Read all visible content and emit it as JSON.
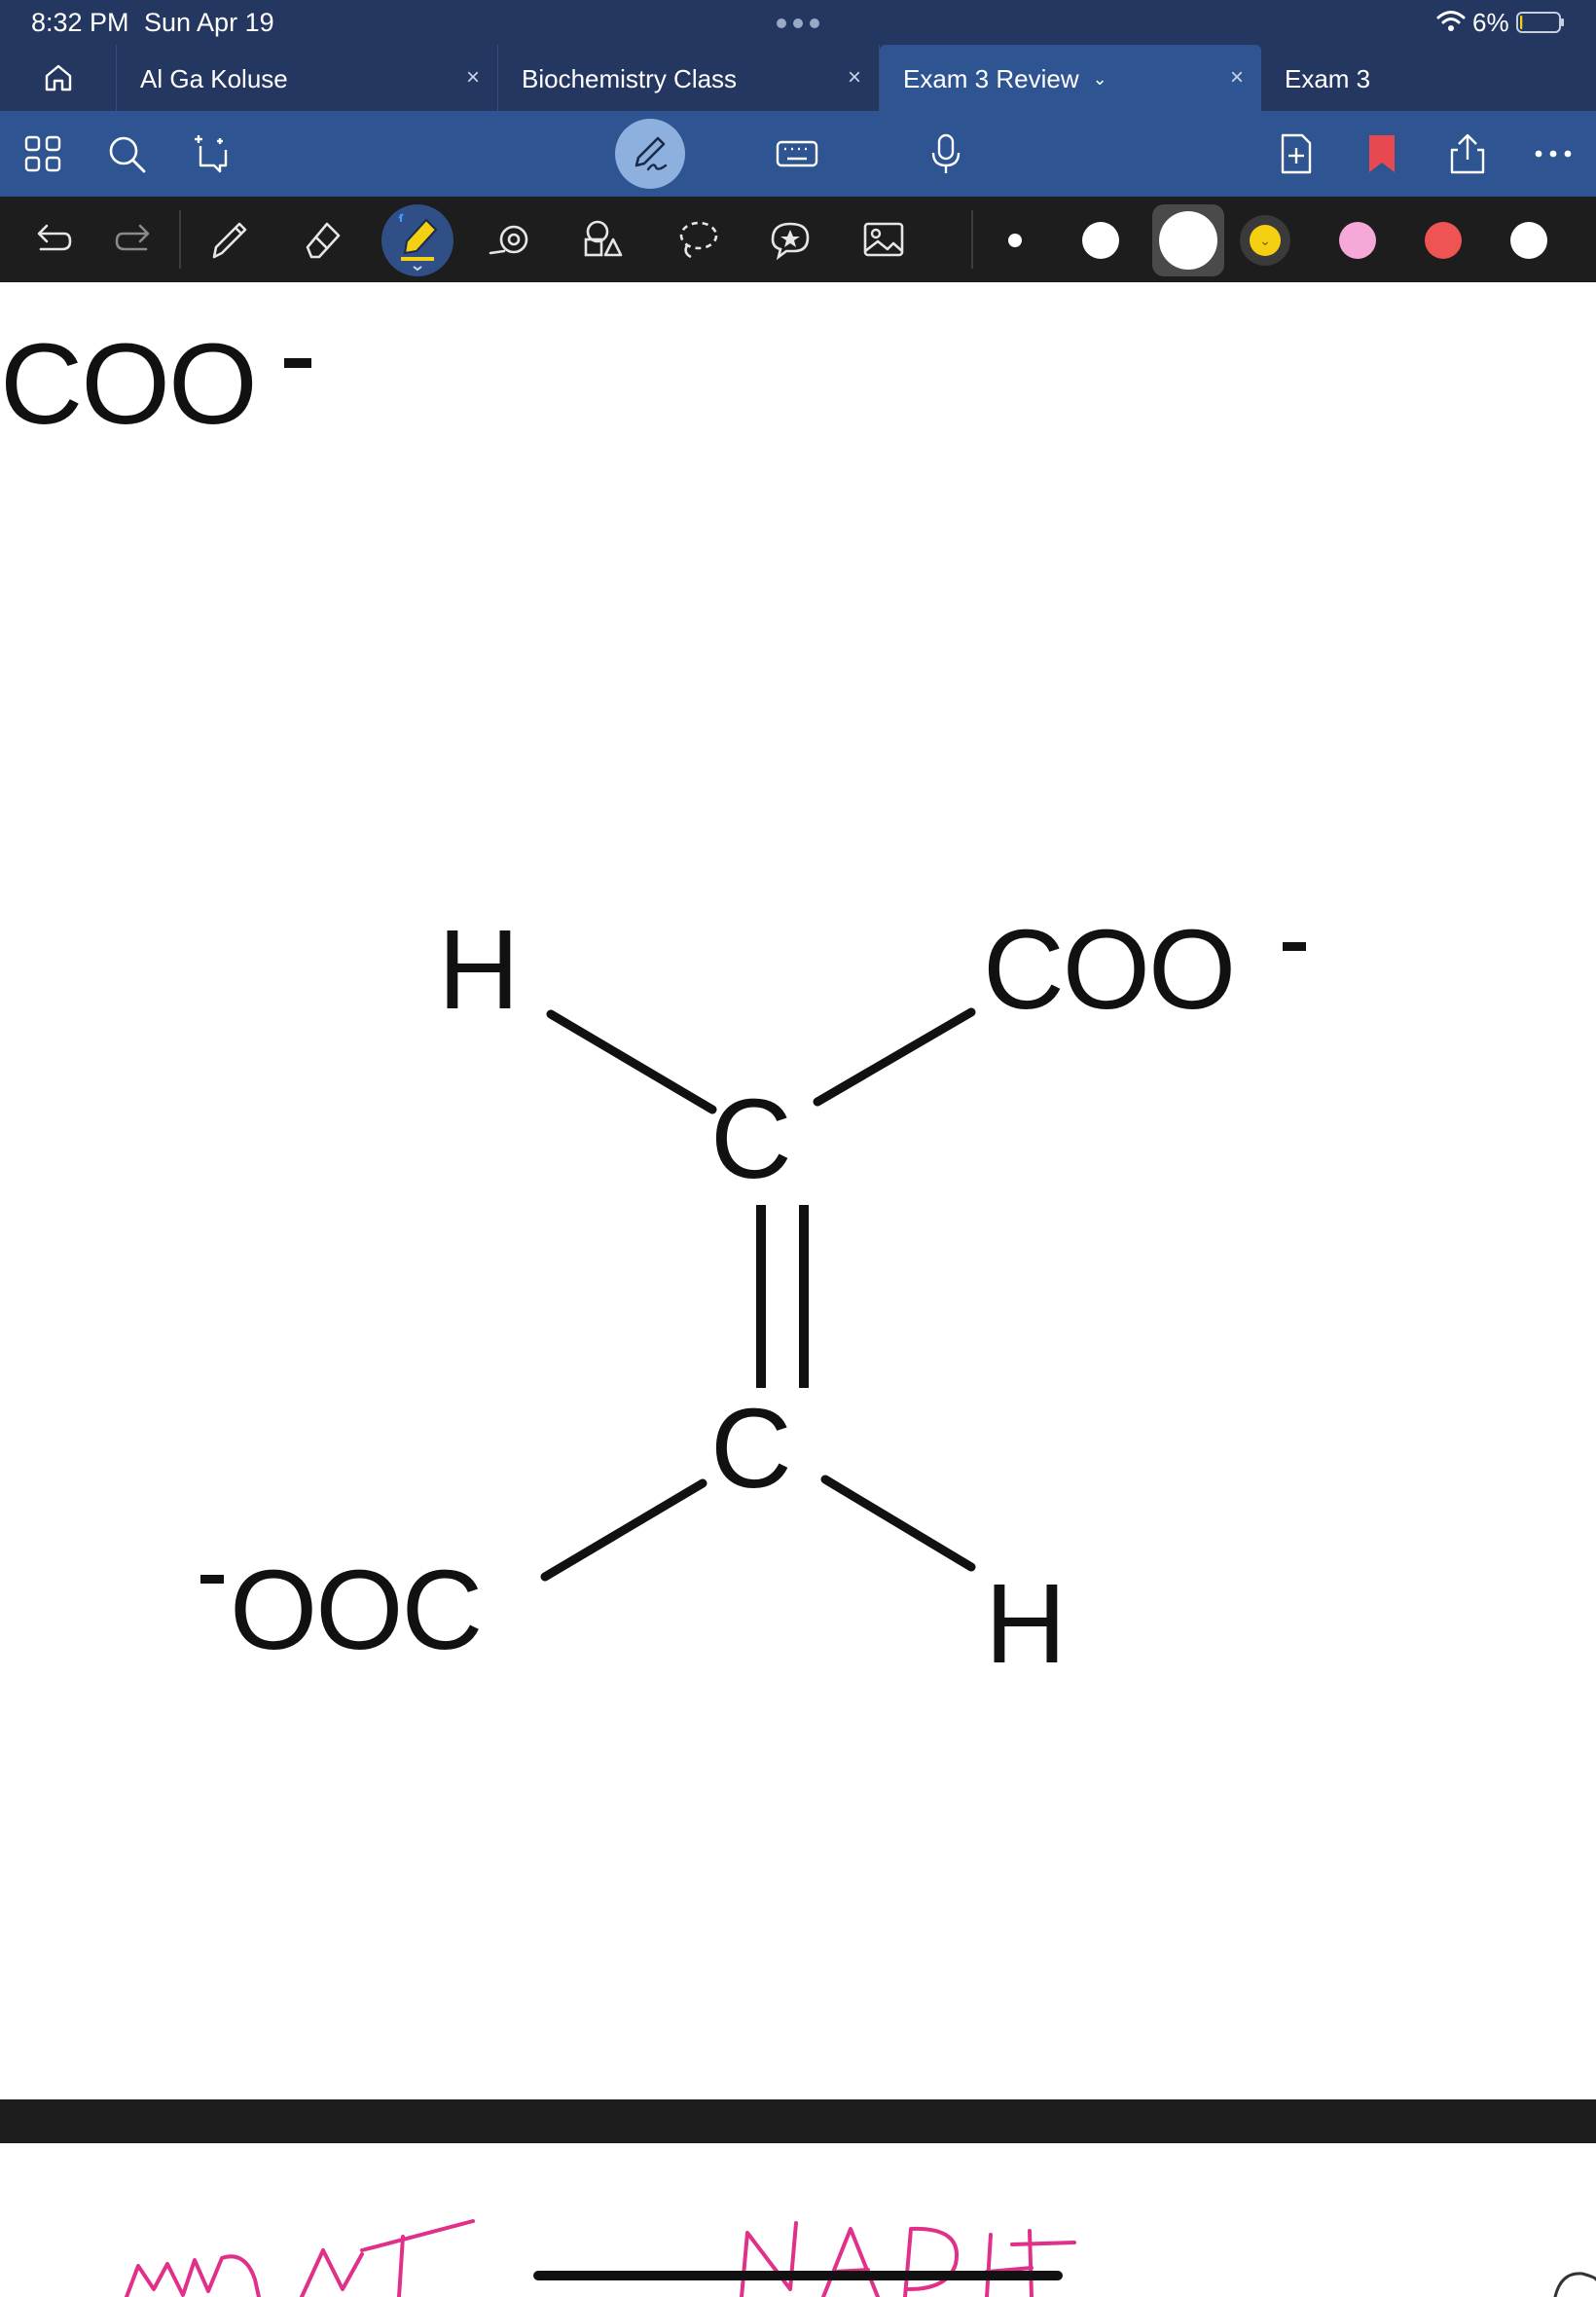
{
  "status_bar": {
    "time": "8:32 PM",
    "date": "Sun Apr 19",
    "battery_percent": "6%",
    "battery_level": 0.06
  },
  "tabs": {
    "home_icon": "home-icon",
    "items": [
      {
        "label": "Al Ga Koluse",
        "active": false,
        "closable": true
      },
      {
        "label": "Biochemistry Class",
        "active": false,
        "closable": true
      },
      {
        "label": "Exam 3 Review",
        "active": true,
        "closable": true
      },
      {
        "label": "Exam 3",
        "active": false,
        "closable": false
      }
    ],
    "close_glyph": "×",
    "dropdown_glyph": "⌄"
  },
  "top_toolbar": {
    "left_icons": [
      "grid-icon",
      "search-icon",
      "lasso-add-icon"
    ],
    "center_icons": [
      "handwriting-mode-icon",
      "keyboard-icon",
      "microphone-icon"
    ],
    "right_icons": [
      "add-page-icon",
      "bookmark-icon",
      "share-icon",
      "more-icon"
    ],
    "accent_color": "#2e5592",
    "bookmark_color": "#e8484f"
  },
  "tools_bar": {
    "tools": [
      "undo-icon",
      "redo-icon",
      "pen-icon",
      "eraser-icon",
      "highlighter-icon",
      "shape-lasso-icon",
      "shapes-icon",
      "lasso-icon",
      "sticker-icon",
      "image-icon"
    ],
    "active_tool": "highlighter-icon",
    "colors": [
      "#ffffff",
      "#ffffff",
      "#ffffff",
      "#f5cf12",
      "#f6a8d8",
      "#ef5454",
      "#ffffff"
    ],
    "selected_color_index": 2
  },
  "document": {
    "header_fragment": {
      "text": "COO",
      "charge": "-"
    },
    "molecule": {
      "top_left": "H",
      "top_right": "COO",
      "carbon_top": "C",
      "carbon_bottom": "C",
      "bottom_left": "OOC",
      "bottom_right": "H",
      "charge": "-"
    }
  }
}
